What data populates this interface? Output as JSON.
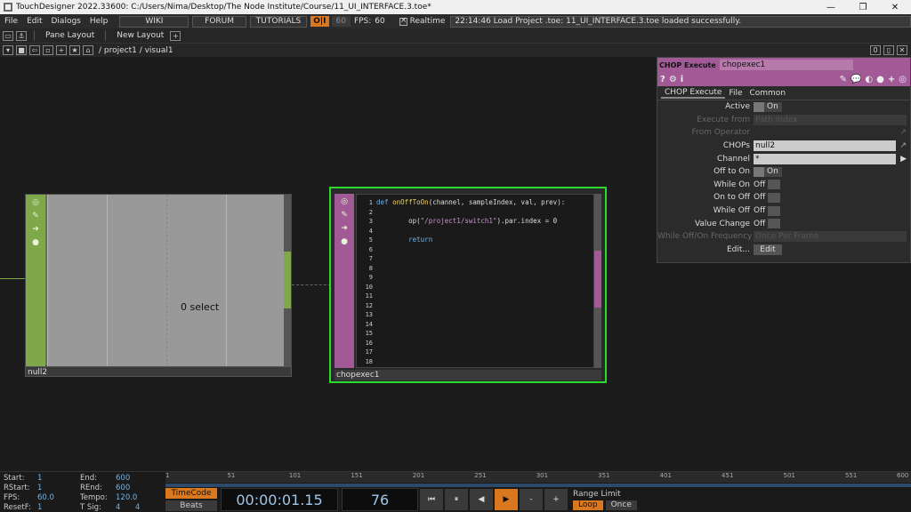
{
  "window": {
    "title": "TouchDesigner 2022.33600: C:/Users/Nima/Desktop/The Node Institute/Course/11_UI_INTERFACE.3.toe*",
    "minimize": "—",
    "maximize": "❐",
    "close": "✕"
  },
  "menu": {
    "items": [
      "File",
      "Edit",
      "Dialogs",
      "Help"
    ],
    "wiki": "WIKI",
    "forum": "FORUM",
    "tutorials": "TUTORIALS",
    "oii": "O|I",
    "fps_value": "60",
    "fps_label": "FPS:",
    "fps_current": "60",
    "realtime": "Realtime",
    "status": "22:14:46 Load Project .toe: 11_UI_INTERFACE.3.toe loaded successfully."
  },
  "panebar": {
    "pane_layout": "Pane Layout",
    "new_layout": "New Layout",
    "plus": "+"
  },
  "pathbar": {
    "path": "/ project1 / visual1",
    "right_num": "0"
  },
  "nodes": {
    "null": {
      "name": "null2",
      "display": "0 select"
    },
    "exec": {
      "name": "chopexec1",
      "line_numbers": [
        "1",
        "2",
        "3",
        "4",
        "5",
        "6",
        "7",
        "8",
        "9",
        "10",
        "11",
        "12",
        "13",
        "14",
        "15",
        "16",
        "17",
        "18"
      ],
      "code_def": "def",
      "code_fn": "onOffToOn",
      "code_sig": "(channel, sampleIndex, val, prev):",
      "code_op_pre": "op(",
      "code_op_str": "\"/project1/switch1\"",
      "code_op_post": ").par.index = 0",
      "code_return": "return"
    }
  },
  "param": {
    "type": "CHOP Execute",
    "name": "chopexec1",
    "tools": {
      "help": "?",
      "info": "i"
    },
    "tabs": [
      "CHOP Execute",
      "File",
      "Common"
    ],
    "rows": {
      "active": {
        "label": "Active",
        "value": "On"
      },
      "execute_from": {
        "label": "Execute from",
        "value": "Path Index"
      },
      "from_operator": {
        "label": "From Operator"
      },
      "chops": {
        "label": "CHOPs",
        "value": "null2"
      },
      "channel": {
        "label": "Channel",
        "value": "*"
      },
      "off_to_on": {
        "label": "Off to On",
        "value": "On"
      },
      "while_on": {
        "label": "While On",
        "value": "Off"
      },
      "on_to_off": {
        "label": "On to Off",
        "value": "Off"
      },
      "while_off": {
        "label": "While Off",
        "value": "Off"
      },
      "value_change": {
        "label": "Value Change",
        "value": "Off"
      },
      "frequency": {
        "label": "While Off/On Frequency",
        "value": "Once Per Frame"
      },
      "edit": {
        "label": "Edit...",
        "value": "Edit"
      }
    }
  },
  "timeline": {
    "info": {
      "start_label": "Start:",
      "start": "1",
      "end_label": "End:",
      "end": "600",
      "rstart_label": "RStart:",
      "rstart": "1",
      "rend_label": "REnd:",
      "rend": "600",
      "fps_label": "FPS:",
      "fps": "60.0",
      "tempo_label": "Tempo:",
      "tempo": "120.0",
      "resetf_label": "ResetF:",
      "resetf": "1",
      "tsig_label": "T Sig:",
      "tsig_a": "4",
      "tsig_b": "4"
    },
    "ticks": [
      "1",
      "51",
      "101",
      "151",
      "201",
      "251",
      "301",
      "351",
      "401",
      "451",
      "501",
      "551",
      "600"
    ],
    "timecode": "TimeCode",
    "beats": "Beats",
    "time": "00:00:01.15",
    "frame": "76",
    "range_limit": "Range Limit",
    "loop": "Loop",
    "once": "Once"
  },
  "colors": {
    "null_green": "#7fa84a",
    "exec_purple": "#a25a96",
    "selected_outline": "#2bdb2b",
    "accent_orange": "#d9781f"
  }
}
